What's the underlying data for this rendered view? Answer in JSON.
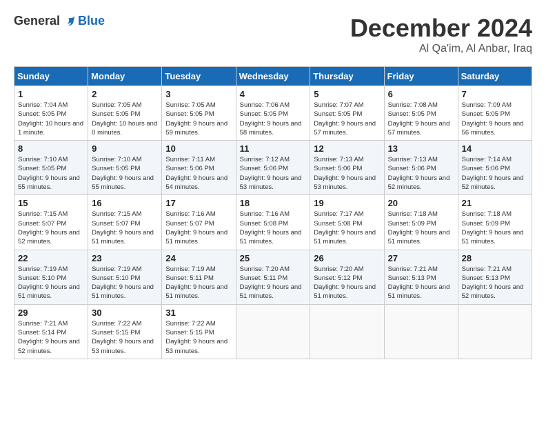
{
  "header": {
    "logo_general": "General",
    "logo_blue": "Blue",
    "month_year": "December 2024",
    "location": "Al Qa'im, Al Anbar, Iraq"
  },
  "days_of_week": [
    "Sunday",
    "Monday",
    "Tuesday",
    "Wednesday",
    "Thursday",
    "Friday",
    "Saturday"
  ],
  "weeks": [
    [
      {
        "day": "1",
        "sunrise": "7:04 AM",
        "sunset": "5:05 PM",
        "daylight": "10 hours and 1 minute."
      },
      {
        "day": "2",
        "sunrise": "7:05 AM",
        "sunset": "5:05 PM",
        "daylight": "10 hours and 0 minutes."
      },
      {
        "day": "3",
        "sunrise": "7:05 AM",
        "sunset": "5:05 PM",
        "daylight": "9 hours and 59 minutes."
      },
      {
        "day": "4",
        "sunrise": "7:06 AM",
        "sunset": "5:05 PM",
        "daylight": "9 hours and 58 minutes."
      },
      {
        "day": "5",
        "sunrise": "7:07 AM",
        "sunset": "5:05 PM",
        "daylight": "9 hours and 57 minutes."
      },
      {
        "day": "6",
        "sunrise": "7:08 AM",
        "sunset": "5:05 PM",
        "daylight": "9 hours and 57 minutes."
      },
      {
        "day": "7",
        "sunrise": "7:09 AM",
        "sunset": "5:05 PM",
        "daylight": "9 hours and 56 minutes."
      }
    ],
    [
      {
        "day": "8",
        "sunrise": "7:10 AM",
        "sunset": "5:05 PM",
        "daylight": "9 hours and 55 minutes."
      },
      {
        "day": "9",
        "sunrise": "7:10 AM",
        "sunset": "5:05 PM",
        "daylight": "9 hours and 55 minutes."
      },
      {
        "day": "10",
        "sunrise": "7:11 AM",
        "sunset": "5:06 PM",
        "daylight": "9 hours and 54 minutes."
      },
      {
        "day": "11",
        "sunrise": "7:12 AM",
        "sunset": "5:06 PM",
        "daylight": "9 hours and 53 minutes."
      },
      {
        "day": "12",
        "sunrise": "7:13 AM",
        "sunset": "5:06 PM",
        "daylight": "9 hours and 53 minutes."
      },
      {
        "day": "13",
        "sunrise": "7:13 AM",
        "sunset": "5:06 PM",
        "daylight": "9 hours and 52 minutes."
      },
      {
        "day": "14",
        "sunrise": "7:14 AM",
        "sunset": "5:06 PM",
        "daylight": "9 hours and 52 minutes."
      }
    ],
    [
      {
        "day": "15",
        "sunrise": "7:15 AM",
        "sunset": "5:07 PM",
        "daylight": "9 hours and 52 minutes."
      },
      {
        "day": "16",
        "sunrise": "7:15 AM",
        "sunset": "5:07 PM",
        "daylight": "9 hours and 51 minutes."
      },
      {
        "day": "17",
        "sunrise": "7:16 AM",
        "sunset": "5:07 PM",
        "daylight": "9 hours and 51 minutes."
      },
      {
        "day": "18",
        "sunrise": "7:16 AM",
        "sunset": "5:08 PM",
        "daylight": "9 hours and 51 minutes."
      },
      {
        "day": "19",
        "sunrise": "7:17 AM",
        "sunset": "5:08 PM",
        "daylight": "9 hours and 51 minutes."
      },
      {
        "day": "20",
        "sunrise": "7:18 AM",
        "sunset": "5:09 PM",
        "daylight": "9 hours and 51 minutes."
      },
      {
        "day": "21",
        "sunrise": "7:18 AM",
        "sunset": "5:09 PM",
        "daylight": "9 hours and 51 minutes."
      }
    ],
    [
      {
        "day": "22",
        "sunrise": "7:19 AM",
        "sunset": "5:10 PM",
        "daylight": "9 hours and 51 minutes."
      },
      {
        "day": "23",
        "sunrise": "7:19 AM",
        "sunset": "5:10 PM",
        "daylight": "9 hours and 51 minutes."
      },
      {
        "day": "24",
        "sunrise": "7:19 AM",
        "sunset": "5:11 PM",
        "daylight": "9 hours and 51 minutes."
      },
      {
        "day": "25",
        "sunrise": "7:20 AM",
        "sunset": "5:11 PM",
        "daylight": "9 hours and 51 minutes."
      },
      {
        "day": "26",
        "sunrise": "7:20 AM",
        "sunset": "5:12 PM",
        "daylight": "9 hours and 51 minutes."
      },
      {
        "day": "27",
        "sunrise": "7:21 AM",
        "sunset": "5:13 PM",
        "daylight": "9 hours and 51 minutes."
      },
      {
        "day": "28",
        "sunrise": "7:21 AM",
        "sunset": "5:13 PM",
        "daylight": "9 hours and 52 minutes."
      }
    ],
    [
      {
        "day": "29",
        "sunrise": "7:21 AM",
        "sunset": "5:14 PM",
        "daylight": "9 hours and 52 minutes."
      },
      {
        "day": "30",
        "sunrise": "7:22 AM",
        "sunset": "5:15 PM",
        "daylight": "9 hours and 53 minutes."
      },
      {
        "day": "31",
        "sunrise": "7:22 AM",
        "sunset": "5:15 PM",
        "daylight": "9 hours and 53 minutes."
      },
      null,
      null,
      null,
      null
    ]
  ]
}
